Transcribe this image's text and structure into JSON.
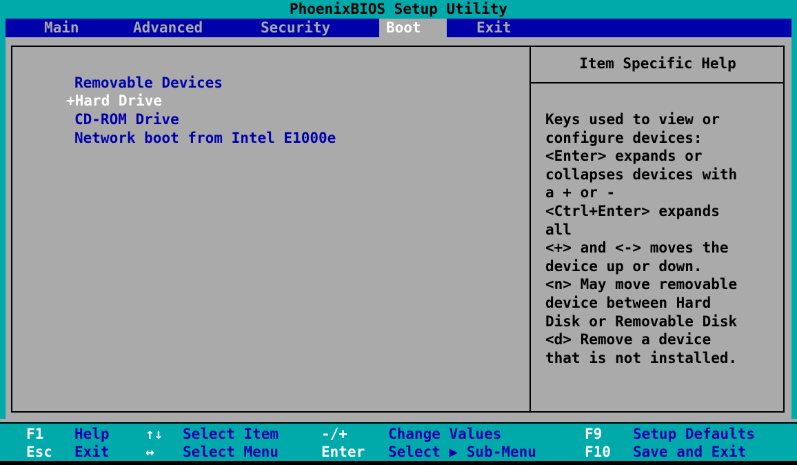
{
  "title": "PhoenixBIOS Setup Utility",
  "menu": [
    {
      "label": "Main",
      "active": false
    },
    {
      "label": "Advanced",
      "active": false
    },
    {
      "label": "Security",
      "active": false
    },
    {
      "label": "Boot",
      "active": true
    },
    {
      "label": "Exit",
      "active": false
    }
  ],
  "boot_list": [
    {
      "label": "Removable Devices",
      "selected": false
    },
    {
      "label": "+Hard Drive",
      "selected": true
    },
    {
      "label": "CD-ROM Drive",
      "selected": false
    },
    {
      "label": "Network boot from Intel E1000e",
      "selected": false
    }
  ],
  "help": {
    "title": "Item Specific Help",
    "lines": [
      "Keys used to view or",
      "configure devices:",
      "<Enter> expands or",
      "collapses devices with",
      "a + or -",
      "<Ctrl+Enter> expands",
      "all",
      "<+> and <-> moves the",
      "device up or down.",
      "<n> May move removable",
      "device between Hard",
      "Disk or Removable Disk",
      "<d> Remove a device",
      "that is not installed."
    ]
  },
  "footer": {
    "row1": [
      {
        "key": "F1",
        "desc": "Help"
      },
      {
        "key": "↑↓",
        "desc": "Select Item"
      },
      {
        "key": "-/+",
        "desc": "Change Values"
      },
      {
        "key": "F9",
        "desc": "Setup Defaults"
      }
    ],
    "row2": [
      {
        "key": "Esc",
        "desc": "Exit"
      },
      {
        "key": "↔",
        "desc": "Select Menu"
      },
      {
        "key": "Enter",
        "desc": "Select ▶ Sub-Menu"
      },
      {
        "key": "F10",
        "desc": "Save and Exit"
      }
    ]
  },
  "colors": {
    "title_bg": "#00aaaa",
    "menu_bg": "#0000aa",
    "panel_bg": "#aaaaaa",
    "item_text": "#0000aa",
    "selected_text": "#ffffff"
  }
}
